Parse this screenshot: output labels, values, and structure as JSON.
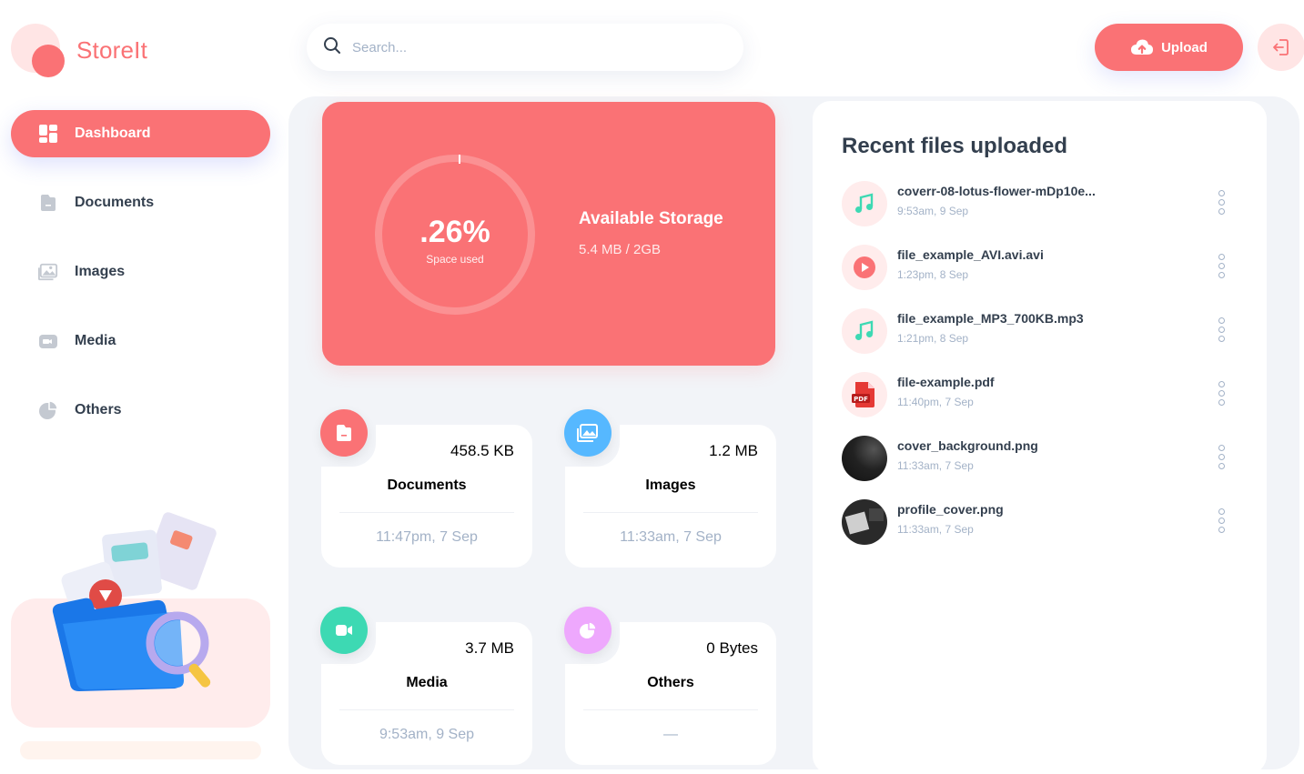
{
  "app": {
    "name": "StoreIt"
  },
  "search": {
    "placeholder": "Search..."
  },
  "header": {
    "upload_label": "Upload"
  },
  "sidebar": {
    "items": [
      {
        "label": "Dashboard",
        "icon": "dashboard-icon",
        "active": true
      },
      {
        "label": "Documents",
        "icon": "document-icon",
        "active": false
      },
      {
        "label": "Images",
        "icon": "image-icon",
        "active": false
      },
      {
        "label": "Media",
        "icon": "video-icon",
        "active": false
      },
      {
        "label": "Others",
        "icon": "pie-icon",
        "active": false
      }
    ]
  },
  "storage": {
    "percent": ".26%",
    "percent_label": "Space used",
    "title": "Available Storage",
    "usage": "5.4 MB / 2GB",
    "used_fraction": 0.0026
  },
  "categories": [
    {
      "label": "Documents",
      "size": "458.5 KB",
      "date": "11:47pm, 7 Sep",
      "color": "#FA7275",
      "icon": "document-icon"
    },
    {
      "label": "Images",
      "size": "1.2 MB",
      "date": "11:33am, 7 Sep",
      "color": "#56B8FF",
      "icon": "image-icon"
    },
    {
      "label": "Media",
      "size": "3.7 MB",
      "date": "9:53am, 9 Sep",
      "color": "#3DD9B3",
      "icon": "video-icon"
    },
    {
      "label": "Others",
      "size": "0 Bytes",
      "date": "—",
      "color": "#EEA8FD",
      "icon": "pie-icon"
    }
  ],
  "recent": {
    "title": "Recent files uploaded",
    "files": [
      {
        "name": "coverr-08-lotus-flower-mDp10e...",
        "date": "9:53am, 9 Sep",
        "type": "audio"
      },
      {
        "name": "file_example_AVI.avi.avi",
        "date": "1:23pm, 8 Sep",
        "type": "video"
      },
      {
        "name": "file_example_MP3_700KB.mp3",
        "date": "1:21pm, 8 Sep",
        "type": "audio"
      },
      {
        "name": "file-example.pdf",
        "date": "11:40pm, 7 Sep",
        "type": "pdf"
      },
      {
        "name": "cover_background.png",
        "date": "11:33am, 7 Sep",
        "type": "image-dark"
      },
      {
        "name": "profile_cover.png",
        "date": "11:33am, 7 Sep",
        "type": "image-gray"
      }
    ]
  }
}
